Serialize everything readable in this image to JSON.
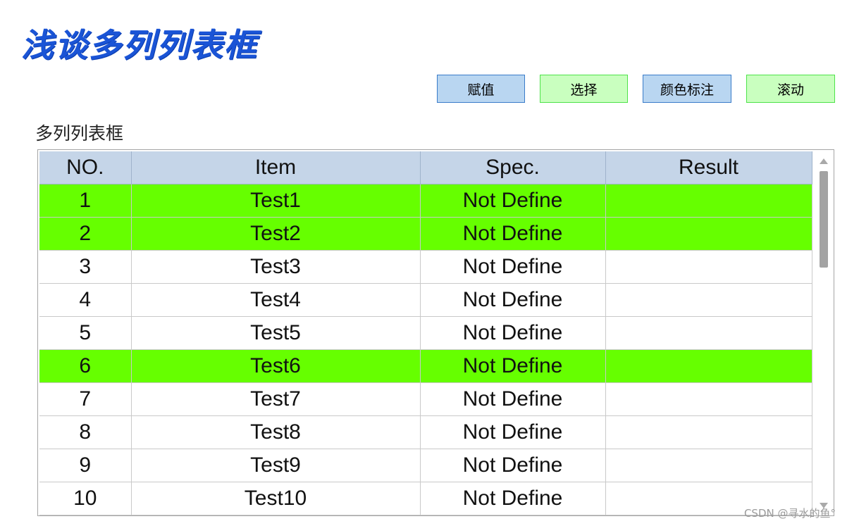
{
  "title": "浅谈多列列表框",
  "buttons": [
    {
      "label": "赋值",
      "color": "#b9d6f1"
    },
    {
      "label": "选择",
      "color": "#c9ffbf"
    },
    {
      "label": "颜色标注",
      "color": "#b9d6f1"
    },
    {
      "label": "滚动",
      "color": "#c9ffbf"
    }
  ],
  "listbox": {
    "label": "多列列表框",
    "highlight_color": "#66ff00",
    "headers": [
      "NO.",
      "Item",
      "Spec.",
      "Result"
    ],
    "rows": [
      {
        "no": "1",
        "item": "Test1",
        "spec": "Not Define",
        "result": "",
        "highlighted": true
      },
      {
        "no": "2",
        "item": "Test2",
        "spec": "Not Define",
        "result": "",
        "highlighted": true
      },
      {
        "no": "3",
        "item": "Test3",
        "spec": "Not Define",
        "result": "",
        "highlighted": false
      },
      {
        "no": "4",
        "item": "Test4",
        "spec": "Not Define",
        "result": "",
        "highlighted": false
      },
      {
        "no": "5",
        "item": "Test5",
        "spec": "Not Define",
        "result": "",
        "highlighted": false
      },
      {
        "no": "6",
        "item": "Test6",
        "spec": "Not Define",
        "result": "",
        "highlighted": true
      },
      {
        "no": "7",
        "item": "Test7",
        "spec": "Not Define",
        "result": "",
        "highlighted": false
      },
      {
        "no": "8",
        "item": "Test8",
        "spec": "Not Define",
        "result": "",
        "highlighted": false
      },
      {
        "no": "9",
        "item": "Test9",
        "spec": "Not Define",
        "result": "",
        "highlighted": false
      },
      {
        "no": "10",
        "item": "Test10",
        "spec": "Not Define",
        "result": "",
        "highlighted": false
      }
    ]
  },
  "watermark": "CSDN @寻水的鱼°"
}
